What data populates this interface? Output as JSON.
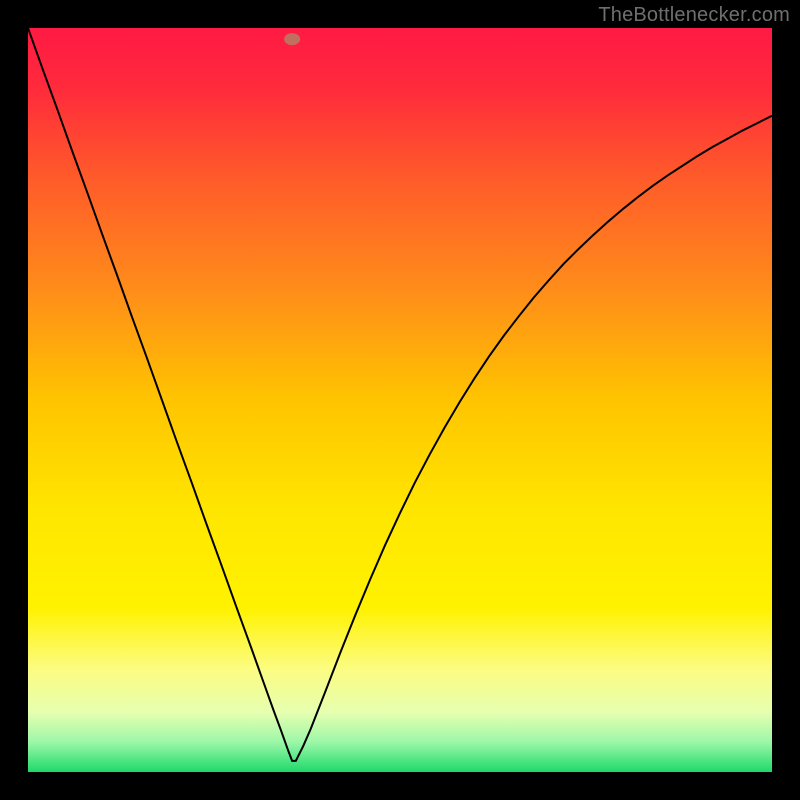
{
  "watermark": "TheBottlenecker.com",
  "chart_data": {
    "type": "line",
    "title": "",
    "xlabel": "",
    "ylabel": "",
    "xlim": [
      0,
      1
    ],
    "ylim": [
      0,
      1
    ],
    "background_gradient": {
      "stops": [
        {
          "offset": 0.0,
          "color": "#ff1a44"
        },
        {
          "offset": 0.08,
          "color": "#ff2a3c"
        },
        {
          "offset": 0.2,
          "color": "#ff5a2a"
        },
        {
          "offset": 0.35,
          "color": "#ff8c1a"
        },
        {
          "offset": 0.5,
          "color": "#ffc400"
        },
        {
          "offset": 0.65,
          "color": "#ffe600"
        },
        {
          "offset": 0.78,
          "color": "#fff200"
        },
        {
          "offset": 0.86,
          "color": "#fcfc80"
        },
        {
          "offset": 0.92,
          "color": "#e6ffb0"
        },
        {
          "offset": 0.96,
          "color": "#9cf7a8"
        },
        {
          "offset": 1.0,
          "color": "#1ed96b"
        }
      ]
    },
    "marker": {
      "x": 0.355,
      "y": 0.985,
      "color": "#c17060"
    },
    "series": [
      {
        "name": "curve",
        "color": "#000000",
        "stroke_width": 2,
        "x": [
          0.0,
          0.02,
          0.04,
          0.06,
          0.08,
          0.1,
          0.12,
          0.14,
          0.16,
          0.18,
          0.2,
          0.22,
          0.24,
          0.26,
          0.28,
          0.3,
          0.32,
          0.33,
          0.34,
          0.35,
          0.355,
          0.36,
          0.37,
          0.38,
          0.4,
          0.42,
          0.44,
          0.46,
          0.48,
          0.5,
          0.52,
          0.54,
          0.56,
          0.58,
          0.6,
          0.62,
          0.64,
          0.66,
          0.68,
          0.7,
          0.72,
          0.74,
          0.76,
          0.78,
          0.8,
          0.82,
          0.84,
          0.86,
          0.88,
          0.9,
          0.92,
          0.94,
          0.96,
          0.98,
          1.0
        ],
        "y": [
          1.0,
          0.944,
          0.889,
          0.833,
          0.778,
          0.722,
          0.667,
          0.611,
          0.556,
          0.5,
          0.444,
          0.389,
          0.333,
          0.278,
          0.222,
          0.167,
          0.111,
          0.083,
          0.056,
          0.028,
          0.015,
          0.015,
          0.035,
          0.058,
          0.109,
          0.161,
          0.211,
          0.259,
          0.305,
          0.348,
          0.389,
          0.427,
          0.463,
          0.497,
          0.529,
          0.559,
          0.587,
          0.613,
          0.638,
          0.661,
          0.683,
          0.703,
          0.722,
          0.74,
          0.757,
          0.773,
          0.788,
          0.802,
          0.815,
          0.828,
          0.84,
          0.851,
          0.862,
          0.872,
          0.882
        ]
      }
    ]
  }
}
